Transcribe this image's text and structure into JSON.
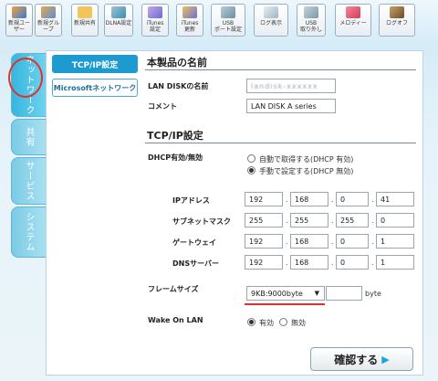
{
  "toolbar": {
    "buttons": [
      {
        "label": "新規ユーザー",
        "icon": "users-icon"
      },
      {
        "label": "新規グループ",
        "icon": "group-icon"
      },
      {
        "label": "新規共有",
        "icon": "folder-icon"
      },
      {
        "label": "DLNA設定",
        "icon": "dlna-icon"
      },
      {
        "label": "iTunes\n設定",
        "icon": "itunes-note-icon"
      },
      {
        "label": "iTunes\n更新",
        "icon": "itunes-update-icon"
      },
      {
        "label": "USB\nポート設定",
        "icon": "usb-icon"
      },
      {
        "label": "ログ表示",
        "icon": "log-icon"
      },
      {
        "label": "USB\n取り外し",
        "icon": "usb-eject-icon"
      },
      {
        "label": "メロディー",
        "icon": "melody-icon"
      },
      {
        "label": "ログオフ",
        "icon": "logoff-icon"
      }
    ]
  },
  "side_tabs": {
    "network": "ネットワーク",
    "share": "共有",
    "service": "サービス",
    "system": "システム"
  },
  "subnav": {
    "tcpip": "TCP/IP設定",
    "microsoft": "Microsoftネットワーク"
  },
  "product": {
    "heading": "本製品の名前",
    "lan_disk_name_label": "LAN DISKの名前",
    "lan_disk_name_value": "landisk-xxxxxx",
    "comment_label": "コメント",
    "comment_value": "LAN DISK A series"
  },
  "tcpip": {
    "heading": "TCP/IP設定",
    "dhcp_label": "DHCP有効/無効",
    "dhcp_auto": "自動で取得する(DHCP 有効)",
    "dhcp_manual": "手動で設定する(DHCP 無効)",
    "ip_label": "IPアドレス",
    "ip": [
      "192",
      "168",
      "0",
      "41"
    ],
    "subnet_label": "サブネットマスク",
    "subnet": [
      "255",
      "255",
      "255",
      "0"
    ],
    "gateway_label": "ゲートウェイ",
    "gateway": [
      "192",
      "168",
      "0",
      "1"
    ],
    "dns_label": "DNSサーバー",
    "dns": [
      "192",
      "168",
      "0",
      "1"
    ],
    "frame_label": "フレームサイズ",
    "frame_value": "9KB:9000byte",
    "frame_custom": "",
    "frame_unit": "byte",
    "wol_label": "Wake On LAN",
    "wol_on": "有効",
    "wol_off": "無効"
  },
  "confirm": {
    "label": "確認する"
  },
  "colors": {
    "accent": "#1d9ad0",
    "tab_active": "#35b6df",
    "highlight_red": "#e4302a"
  }
}
